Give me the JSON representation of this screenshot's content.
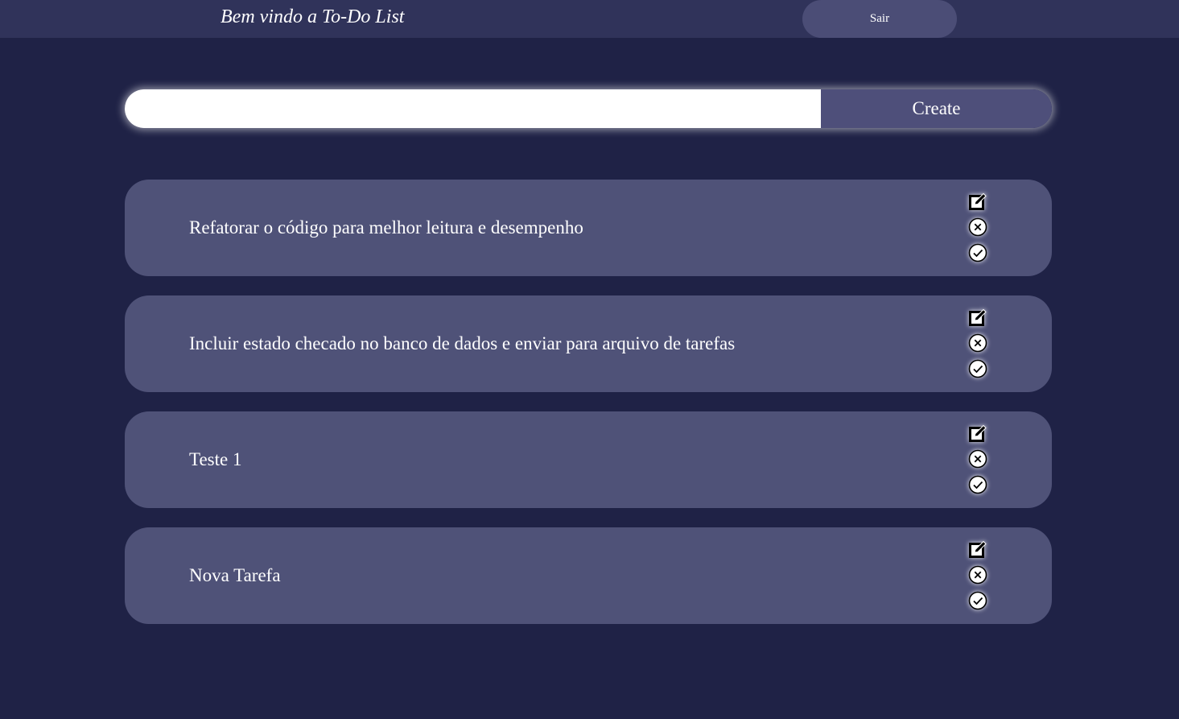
{
  "header": {
    "title": "Bem vindo a To-Do List",
    "logout_label": "Sair"
  },
  "create": {
    "input_value": "",
    "input_placeholder": "",
    "button_label": "Create"
  },
  "tasks": [
    {
      "text": "Refatorar o código para melhor leitura e desempenho"
    },
    {
      "text": "Incluir estado checado no banco de dados e enviar para arquivo de tarefas"
    },
    {
      "text": "Teste 1"
    },
    {
      "text": "Nova Tarefa"
    }
  ],
  "icons": {
    "edit": "edit-icon",
    "delete": "close-circle-icon",
    "complete": "check-circle-icon"
  },
  "colors": {
    "background": "#1f2246",
    "topbar": "#30335a",
    "card": "#4f5278",
    "create_button": "#4e4f7a",
    "logout_button": "#4b4d76"
  }
}
